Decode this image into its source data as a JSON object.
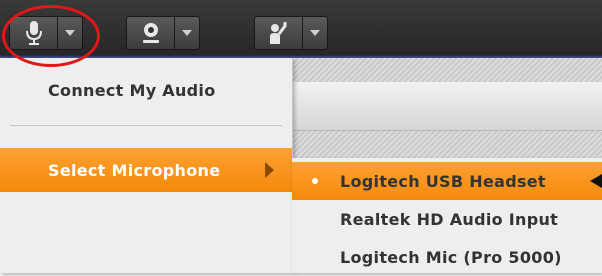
{
  "toolbar": {
    "buttons": [
      {
        "icon": "microphone-icon"
      },
      {
        "icon": "webcam-icon"
      },
      {
        "icon": "raise-hand-icon"
      }
    ]
  },
  "audio_menu": {
    "connect_label": "Connect My Audio",
    "select_mic_label": "Select Microphone"
  },
  "microphone_menu": {
    "items": [
      {
        "label": "Logitech USB Headset",
        "selected": true
      },
      {
        "label": "Realtek HD Audio Input",
        "selected": false
      },
      {
        "label": "Logitech Mic (Pro 5000)",
        "selected": false
      }
    ]
  },
  "colors": {
    "highlight": "#f7931e",
    "annotation_circle": "#e01818",
    "toolbar_bg": "#2f2f2f"
  }
}
